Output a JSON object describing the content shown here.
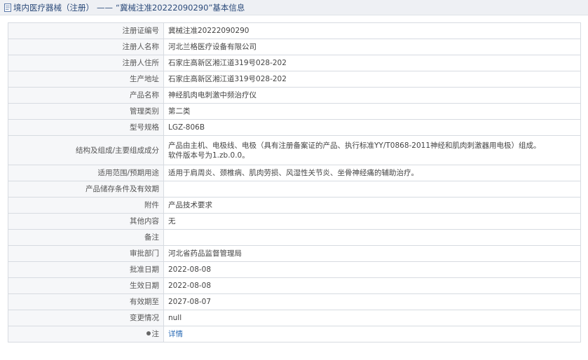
{
  "title": {
    "prefix": "境内医疗器械（注册）",
    "separator": "——",
    "subject": "“冀械注准20222090290”基本信息"
  },
  "rows": [
    {
      "label": "注册证编号",
      "value": "冀械注准20222090290"
    },
    {
      "label": "注册人名称",
      "value": "河北兰格医疗设备有限公司"
    },
    {
      "label": "注册人住所",
      "value": "石家庄高新区湘江道319号028-202"
    },
    {
      "label": "生产地址",
      "value": "石家庄高新区湘江道319号028-202"
    },
    {
      "label": "产品名称",
      "value": "神经肌肉电刺激中频治疗仪"
    },
    {
      "label": "管理类别",
      "value": "第二类"
    },
    {
      "label": "型号规格",
      "value": "LGZ-806B"
    },
    {
      "label": "结构及组成/主要组成成分",
      "value": "产品由主机、电极线、电极（具有注册备案证的产品、执行标准YY/T0868-2011神经和肌肉刺激器用电极）组成。",
      "value2": "软件版本号为1.zb.0.0。"
    },
    {
      "label": "适用范围/预期用途",
      "value": "适用于肩周炎、颈椎病、肌肉劳损、风湿性关节炎、坐骨神经痛的辅助治疗。"
    },
    {
      "label": "产品储存条件及有效期",
      "value": ""
    },
    {
      "label": "附件",
      "value": "产品技术要求"
    },
    {
      "label": "其他内容",
      "value": "无"
    },
    {
      "label": "备注",
      "value": ""
    },
    {
      "label": "审批部门",
      "value": "河北省药品监督管理局"
    },
    {
      "label": "批准日期",
      "value": "2022-08-08"
    },
    {
      "label": "生效日期",
      "value": "2022-08-08"
    },
    {
      "label": "有效期至",
      "value": "2027-08-07"
    },
    {
      "label": "变更情况",
      "value": "null"
    },
    {
      "label": "注",
      "value": "详情"
    }
  ]
}
